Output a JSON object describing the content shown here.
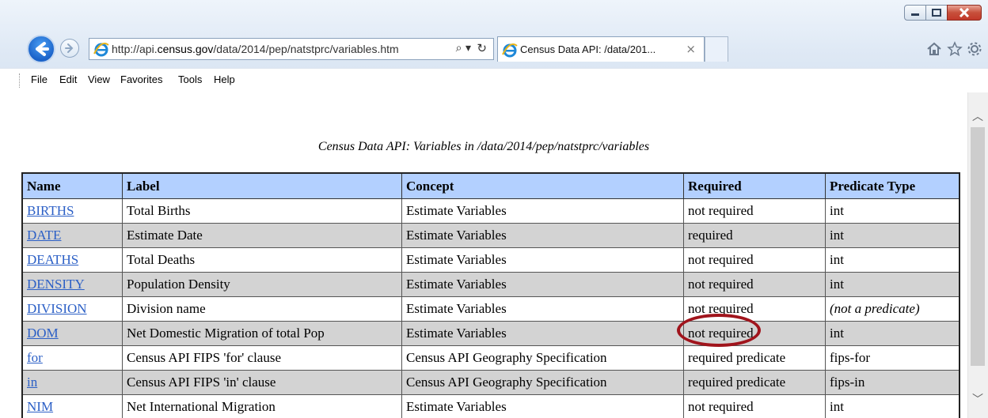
{
  "browser": {
    "url_prefix": "http://api.",
    "url_domain": "census.gov",
    "url_path": "/data/2014/pep/natstprc/variables.htm",
    "search_glyph": "⌕ ▾",
    "refresh_glyph": "↻",
    "tab_title": "Census Data API: /data/201...",
    "tab_close": "×"
  },
  "menu": {
    "items": [
      "File",
      "Edit",
      "View",
      "Favorites",
      "Tools",
      "Help"
    ]
  },
  "page": {
    "caption": "Census Data API: Variables in /data/2014/pep/natstprc/variables",
    "columns": [
      "Name",
      "Label",
      "Concept",
      "Required",
      "Predicate Type"
    ],
    "rows": [
      {
        "name": "BIRTHS",
        "label": "Total Births",
        "concept": "Estimate Variables",
        "required": "not required",
        "predicate": "int"
      },
      {
        "name": "DATE",
        "label": "Estimate Date",
        "concept": "Estimate Variables",
        "required": "required",
        "predicate": "int"
      },
      {
        "name": "DEATHS",
        "label": "Total Deaths",
        "concept": "Estimate Variables",
        "required": "not required",
        "predicate": "int"
      },
      {
        "name": "DENSITY",
        "label": "Population Density",
        "concept": "Estimate Variables",
        "required": "not required",
        "predicate": "int"
      },
      {
        "name": "DIVISION",
        "label": "Division name",
        "concept": "Estimate Variables",
        "required": "not required",
        "predicate": "(not a predicate)"
      },
      {
        "name": "DOM",
        "label": "Net Domestic Migration of total Pop",
        "concept": "Estimate Variables",
        "required": "not required",
        "predicate": "int"
      },
      {
        "name": "for",
        "label": "Census API FIPS 'for' clause",
        "concept": "Census API Geography Specification",
        "required": "required predicate",
        "predicate": "fips-for"
      },
      {
        "name": "in",
        "label": "Census API FIPS 'in' clause",
        "concept": "Census API Geography Specification",
        "required": "required predicate",
        "predicate": "fips-in"
      },
      {
        "name": "NIM",
        "label": "Net International Migration",
        "concept": "Estimate Variables",
        "required": "not required",
        "predicate": "int"
      }
    ]
  },
  "colors": {
    "header_bg": "#b3d0ff",
    "alt_row_bg": "#d3d3d3",
    "link": "#2b5fc6",
    "highlight_circle": "#a0141c"
  },
  "icons": [
    "back-icon",
    "forward-icon",
    "ie-logo-icon",
    "search-icon",
    "refresh-icon",
    "home-icon",
    "favorites-star-icon",
    "settings-gear-icon",
    "minimize-icon",
    "maximize-icon",
    "close-icon"
  ]
}
